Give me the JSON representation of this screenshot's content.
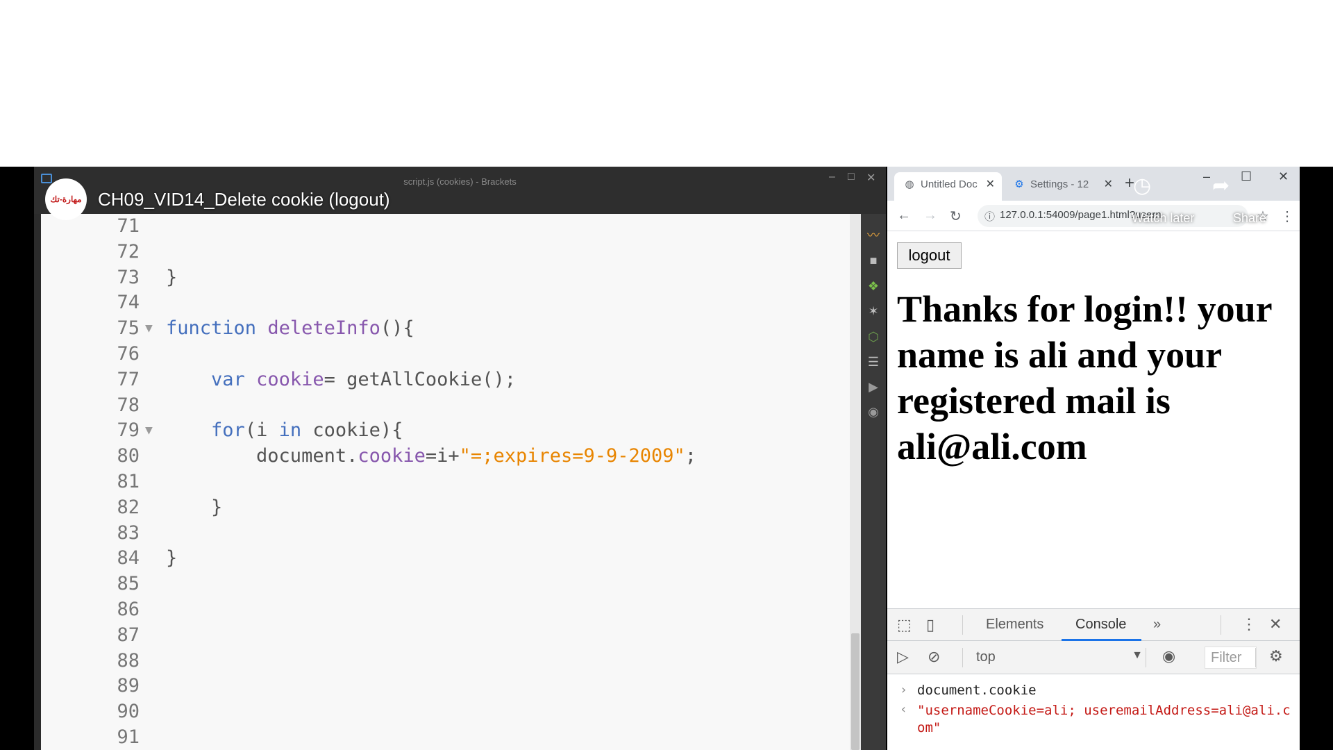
{
  "video": {
    "title": "CH09_VID14_Delete cookie (logout)",
    "channel_logo_text": "مهارة-تك"
  },
  "editor": {
    "window_title": "script.js (cookies) - Brackets",
    "lines": [
      {
        "n": "71",
        "fold": "",
        "html": ""
      },
      {
        "n": "72",
        "fold": "",
        "html": ""
      },
      {
        "n": "73",
        "fold": "",
        "html": "}"
      },
      {
        "n": "74",
        "fold": "",
        "html": ""
      },
      {
        "n": "75",
        "fold": "▼",
        "html": "<span class=\"kw\">function</span> <span class=\"fn\">deleteInfo</span>(){"
      },
      {
        "n": "76",
        "fold": "",
        "html": ""
      },
      {
        "n": "77",
        "fold": "",
        "html": "    <span class=\"kw\">var</span> <span class=\"fn\">cookie</span>= getAllCookie();"
      },
      {
        "n": "78",
        "fold": "",
        "html": ""
      },
      {
        "n": "79",
        "fold": "▼",
        "html": "    <span class=\"kw\">for</span>(i <span class=\"kw\">in</span> cookie){"
      },
      {
        "n": "80",
        "fold": "",
        "html": "        document.<span class=\"fn\">cookie</span>=i+<span class=\"str\">\"=;expires=9-9-2009\"</span>;"
      },
      {
        "n": "81",
        "fold": "",
        "html": ""
      },
      {
        "n": "82",
        "fold": "",
        "html": "    }"
      },
      {
        "n": "83",
        "fold": "",
        "html": ""
      },
      {
        "n": "84",
        "fold": "",
        "html": "}"
      },
      {
        "n": "85",
        "fold": "",
        "html": ""
      },
      {
        "n": "86",
        "fold": "",
        "html": ""
      },
      {
        "n": "87",
        "fold": "",
        "html": ""
      },
      {
        "n": "88",
        "fold": "",
        "html": ""
      },
      {
        "n": "89",
        "fold": "",
        "html": ""
      },
      {
        "n": "90",
        "fold": "",
        "html": ""
      },
      {
        "n": "91",
        "fold": "",
        "html": ""
      }
    ],
    "toolbar_icons": [
      "live-preview-icon",
      "extension-manager-icon",
      "gift-icon",
      "magic-wand-icon",
      "nodejs-icon",
      "list-icon",
      "pin-icon",
      "lightbulb-icon"
    ]
  },
  "browser": {
    "tabs": [
      {
        "label": "Untitled Doc",
        "icon": "globe-icon"
      },
      {
        "label": "Settings - 12",
        "icon": "gear-icon"
      }
    ],
    "url": "127.0.0.1:54009/page1.html?usern",
    "overlay": {
      "watch_later": "Watch later",
      "share": "Share"
    },
    "page": {
      "logout_label": "logout",
      "heading": "Thanks for login!! your name is ali and your registered mail is ali@ali.com"
    }
  },
  "devtools": {
    "tabs": [
      "Elements",
      "Console"
    ],
    "active_tab": "Console",
    "more": "»",
    "context": "top",
    "filter_placeholder": "Filter",
    "console": {
      "command": "document.cookie",
      "result": "\"usernameCookie=ali; useremailAddress=ali@ali.com\""
    }
  },
  "colors": {
    "keyword": "#446fbd",
    "identifier": "#8757ad",
    "string": "#e88501",
    "console_result": "#c41a16",
    "active_tab_underline": "#1a73e8"
  }
}
